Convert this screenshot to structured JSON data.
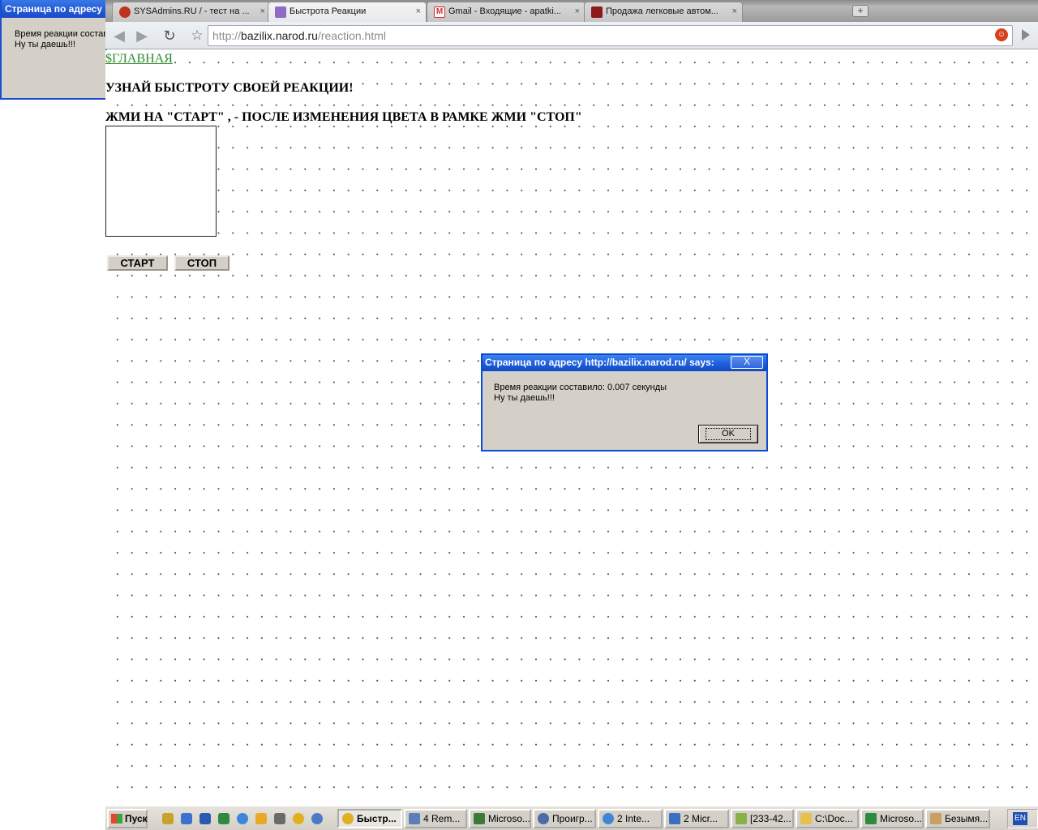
{
  "background_dialog": {
    "title": "Страница по адресу h",
    "line1": "Время реакции состав",
    "line2": "Ну ты даешь!!!"
  },
  "tabs": [
    {
      "label": "SYSAdmins.RU / - тест на ...",
      "close": "×"
    },
    {
      "label": "Быстрота Реакции",
      "close": "×"
    },
    {
      "label": "Gmail - Входящие - apatki...",
      "close": "×"
    },
    {
      "label": "Продажа легковые автом...",
      "close": "×"
    }
  ],
  "toolbar": {
    "back": "◀",
    "forward": "▶",
    "reload": "↻",
    "star": "☆",
    "url_prefix": "http://",
    "url_host": "bazilix.narod.ru",
    "url_path": "/reaction.html"
  },
  "page": {
    "home_link": "$ГЛАВНАЯ",
    "heading": "УЗНАЙ БЫСТРОТУ СВОЕЙ РЕАКЦИИ!",
    "instruction": "ЖМИ НА \"СТАРТ\" , - ПОСЛЕ ИЗМЕНЕНИЯ ЦВЕТА В РАМКЕ ЖМИ \"СТОП\"",
    "start_label": "СТАРТ",
    "stop_label": "СТОП"
  },
  "alert": {
    "title": "Страница по адресу http://bazilix.narod.ru/ says:",
    "close": "X",
    "line1": "Время реакции составило: 0.007 секунды",
    "line2": "Ну ты даешь!!!",
    "ok_label": "OK"
  },
  "taskbar": {
    "start_label": "Пуск",
    "tasks": [
      {
        "label": "Быстр...",
        "active": true
      },
      {
        "label": "4 Rem...",
        "active": false
      },
      {
        "label": "Microso...",
        "active": false
      },
      {
        "label": "Проигр...",
        "active": false
      },
      {
        "label": "2 Inte...",
        "active": false
      },
      {
        "label": "2 Micr...",
        "active": false
      },
      {
        "label": "[233-42...",
        "active": false
      },
      {
        "label": "C:\\Doc...",
        "active": false
      },
      {
        "label": "Microso...",
        "active": false
      },
      {
        "label": "Безымя...",
        "active": false
      }
    ],
    "lang": "EN"
  },
  "colors": {
    "link": "#2e8b2e",
    "title_blue": "#1d5fdc",
    "dialog_face": "#d4d0c8"
  }
}
